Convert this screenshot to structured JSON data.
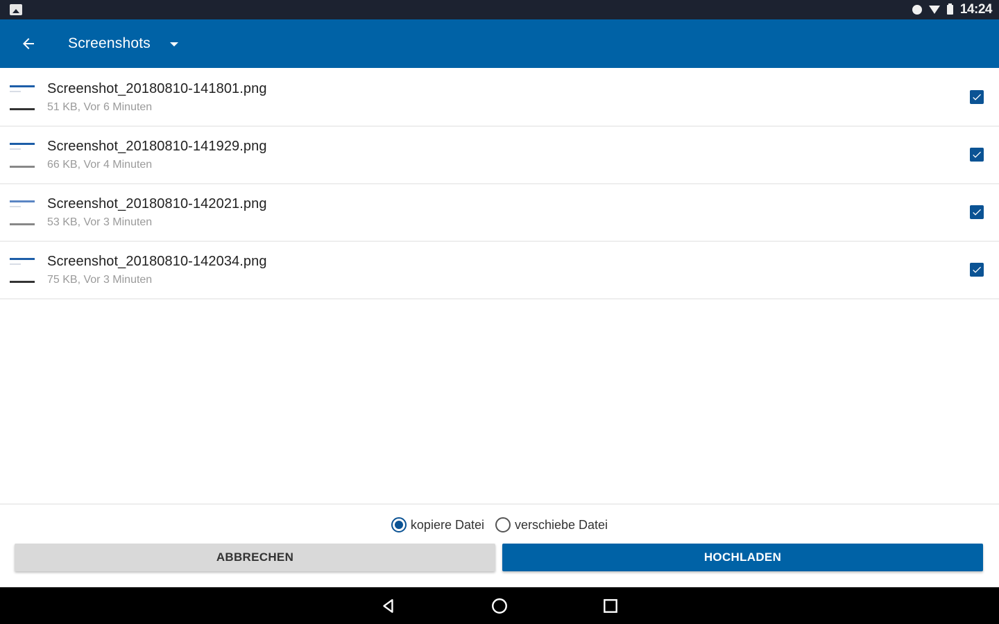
{
  "status_bar": {
    "time": "14:24",
    "icons": [
      "gallery-icon",
      "notification-dot-icon",
      "wifi-icon",
      "battery-icon"
    ]
  },
  "app_bar": {
    "back_icon": "arrow-left-icon",
    "title": "Screenshots",
    "dropdown_icon": "dropdown-triangle-icon",
    "background_color": "#0062a6"
  },
  "files": [
    {
      "name": "Screenshot_20180810-141801.png",
      "meta": "51 KB, Vor 6 Minuten",
      "checked": true
    },
    {
      "name": "Screenshot_20180810-141929.png",
      "meta": "66 KB, Vor 4 Minuten",
      "checked": true
    },
    {
      "name": "Screenshot_20180810-142021.png",
      "meta": "53 KB, Vor 3 Minuten",
      "checked": true
    },
    {
      "name": "Screenshot_20180810-142034.png",
      "meta": "75 KB, Vor 3 Minuten",
      "checked": true
    }
  ],
  "options": {
    "copy_label": "kopiere Datei",
    "move_label": "verschiebe Datei",
    "selected": "copy"
  },
  "buttons": {
    "cancel_label": "ABBRECHEN",
    "upload_label": "HOCHLADEN"
  },
  "nav_bar": {
    "icons": [
      "back-triangle-icon",
      "home-circle-icon",
      "recents-square-icon"
    ]
  }
}
